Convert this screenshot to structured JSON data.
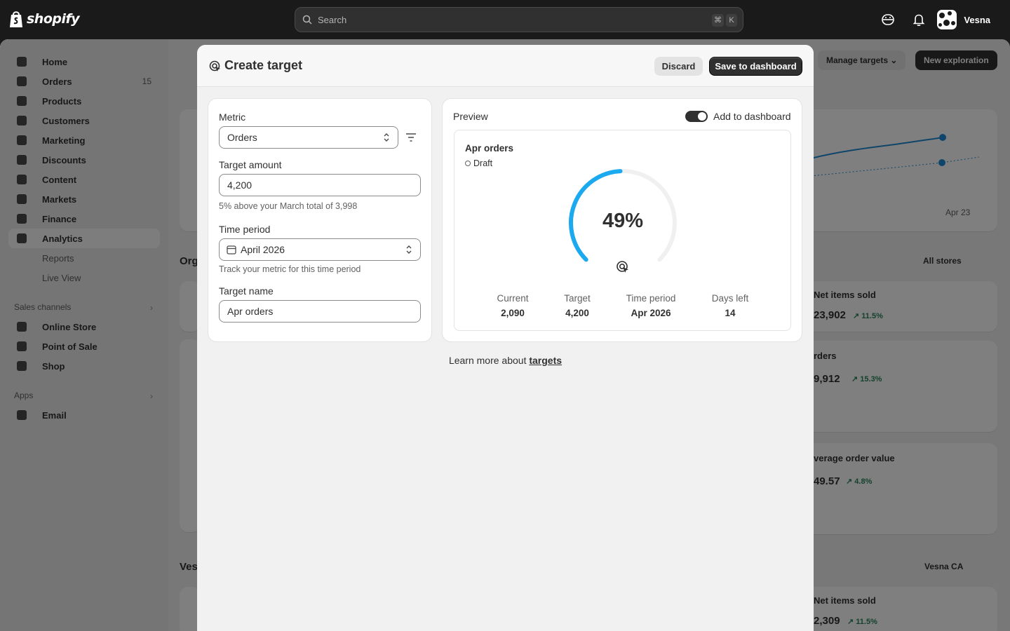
{
  "topbar": {
    "brand": "shopify",
    "search_placeholder": "Search",
    "shortcut_keys": [
      "⌘",
      "K"
    ],
    "user_name": "Vesna"
  },
  "sidebar": {
    "items": [
      {
        "label": "Home",
        "icon": "home-icon"
      },
      {
        "label": "Orders",
        "icon": "orders-icon",
        "badge": "15"
      },
      {
        "label": "Products",
        "icon": "tag-icon"
      },
      {
        "label": "Customers",
        "icon": "person-icon"
      },
      {
        "label": "Marketing",
        "icon": "target-icon"
      },
      {
        "label": "Discounts",
        "icon": "discount-icon"
      },
      {
        "label": "Content",
        "icon": "content-icon"
      },
      {
        "label": "Markets",
        "icon": "globe-icon"
      },
      {
        "label": "Finance",
        "icon": "bank-icon"
      },
      {
        "label": "Analytics",
        "icon": "bar-chart-icon",
        "active": true
      }
    ],
    "analytics_sub": [
      "Reports",
      "Live View"
    ],
    "sales_channels_label": "Sales channels",
    "sales_channels": [
      {
        "label": "Online Store",
        "icon": "store-icon"
      },
      {
        "label": "Point of Sale",
        "icon": "pos-icon"
      },
      {
        "label": "Shop",
        "icon": "shop-icon"
      }
    ],
    "apps_label": "Apps",
    "apps": [
      {
        "label": "Email",
        "icon": "email-icon"
      }
    ]
  },
  "background": {
    "manage_targets": "Manage targets",
    "new_exploration": "New exploration",
    "chart_tick": "Apr 23",
    "all_stores": "All stores",
    "vesna_ca": "Vesna CA",
    "section_org": "Org",
    "section_ves": "Ves",
    "metrics": [
      {
        "label": "Net items sold",
        "value": "23,902",
        "delta": "↗ 11.5%"
      },
      {
        "label": "rders",
        "value": "9,912",
        "delta": "↗ 15.3%"
      },
      {
        "label": "verage order value",
        "value": "49.57",
        "delta": "↗ 4.8%"
      },
      {
        "label": "Net items sold",
        "value": "2,309",
        "delta": "↗ 11.5%"
      }
    ]
  },
  "modal": {
    "title": "Create target",
    "discard_label": "Discard",
    "save_label": "Save to dashboard",
    "form": {
      "metric_label": "Metric",
      "metric_value": "Orders",
      "amount_label": "Target amount",
      "amount_value": "4,200",
      "amount_help": "5% above your March total of 3,998",
      "period_label": "Time period",
      "period_value": "April 2026",
      "period_help": "Track your metric for this time period",
      "name_label": "Target name",
      "name_value": "Apr orders"
    },
    "preview": {
      "label": "Preview",
      "toggle_label": "Add to dashboard",
      "toggle_on": true,
      "card_title": "Apr orders",
      "status": "Draft",
      "progress_pct": "49%",
      "progress_fraction": 0.49,
      "accent_color": "#1ba9f0",
      "track_color": "#f0f0f0",
      "stats": [
        {
          "label": "Current",
          "value": "2,090"
        },
        {
          "label": "Target",
          "value": "4,200"
        },
        {
          "label": "Time period",
          "value": "Apr 2026"
        },
        {
          "label": "Days left",
          "value": "14"
        }
      ]
    },
    "learn_prefix": "Learn more about",
    "learn_link": "targets"
  }
}
